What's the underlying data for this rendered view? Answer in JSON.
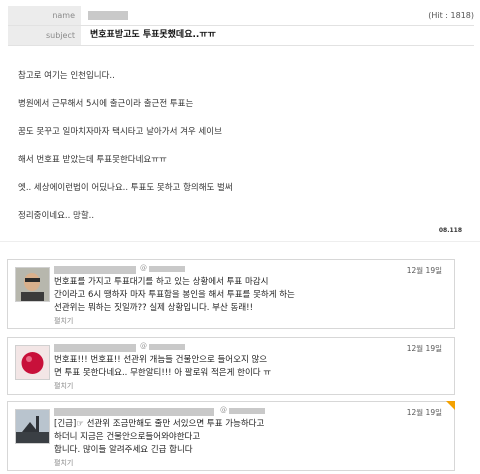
{
  "post": {
    "name_label": "name",
    "subject_label": "subject",
    "hit_text": "(Hit : 1818)",
    "subject": "변호표받고도 투표못했데요..ㅠㅠ",
    "body": [
      "참고로 여기는 인천입니다..",
      "병원에서 근무해서 5시에 출근이라 출근전 투표는",
      "꿈도 못꾸고 일마치자마자 택시타고 날아가서 겨우 세이브",
      "해서 번호표 받았는데 투표못한다네요ㅠㅠ",
      "엣.. 세상에이런법이 어딨나요.. 투표도 못하고 항의해도 벌써",
      "정리중이네요.. 망할.."
    ],
    "stamp": "08.118"
  },
  "comments": [
    {
      "handle": "@",
      "date": "12월 19일",
      "lines": [
        "번호표를 가지고 투표대기를 하고 있는 상황에서 투표 마감시",
        "간이라고 6시 땡하자 마자 투표함을 봉인을 해서 투표를 못하게 하는",
        "선관위는 뭐하는 짓일까?? 실제 상황입니다. 부산 동래!!"
      ],
      "fold": "펼치기"
    },
    {
      "handle": "@",
      "date": "12월 19일",
      "lines": [
        "번호표!!! 번호표!! 선관위 개늠들 건물안으로 들어오지 않으",
        "면 투표 못한다네요.. 무한알티!!! 아 팔로워 적은게 한이다 ㅠ"
      ],
      "fold": "펼치기"
    },
    {
      "handle": "@",
      "date": "12월 19일",
      "lines": [
        "[긴급]☞ 선관위 조금만해도 줄만 서있으면 투표 가능하다고",
        "하더니 지금은 건물안으로들어와야한다고",
        "합니다. 많이들 알려주세요 긴급 합니다"
      ],
      "fold": "펼치기"
    }
  ]
}
